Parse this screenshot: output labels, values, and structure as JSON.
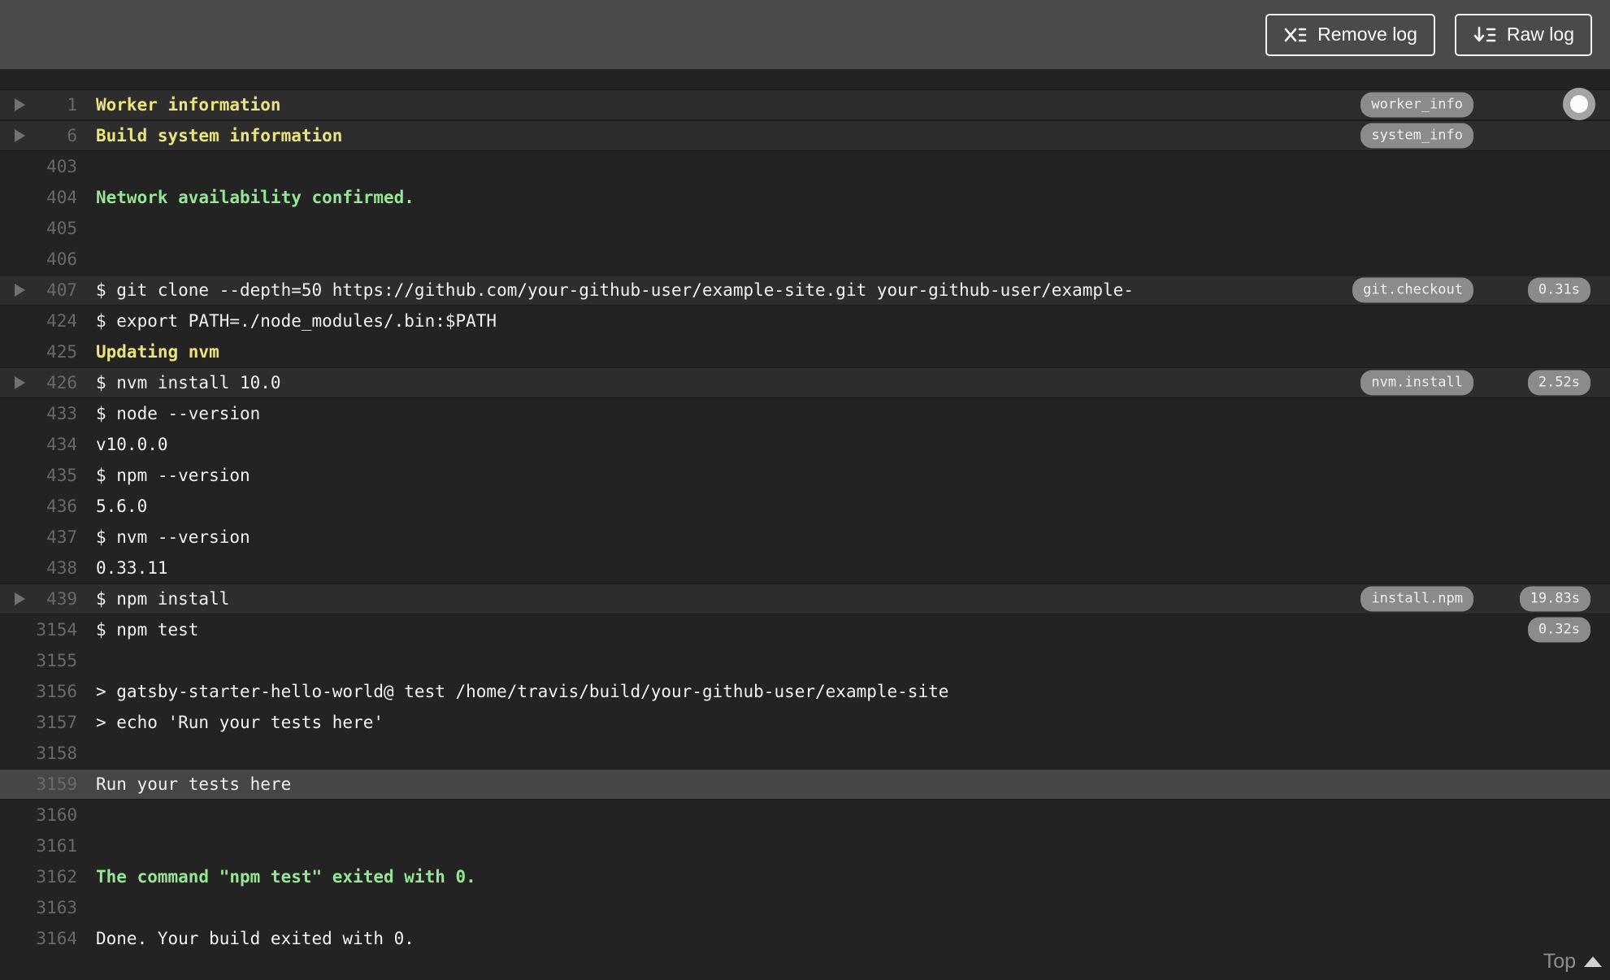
{
  "toolbar": {
    "remove_log_label": "Remove log",
    "raw_log_label": "Raw log"
  },
  "footer": {
    "top_label": "Top"
  },
  "colors": {
    "toolbar_bg": "#4a4a4a",
    "log_bg": "#232323",
    "highlight_row_bg": "#2d2d2d",
    "selected_row_bg": "#464646",
    "fold_title_yellow": "#e9e47c",
    "success_green": "#95e595",
    "log_text": "#f2f2f2",
    "badge_bg": "#8b8b8b"
  },
  "icons": [
    "remove-log-icon",
    "raw-log-icon",
    "fold-toggle-icon",
    "scroll-thumb",
    "top-arrow-icon"
  ],
  "log": {
    "lines": [
      {
        "number": "1",
        "text": "Worker information",
        "style": "fold-title",
        "fold": true,
        "highlight": true,
        "tag": "worker_info"
      },
      {
        "number": "6",
        "text": "Build system information",
        "style": "fold-title",
        "fold": true,
        "highlight": true,
        "tag": "system_info"
      },
      {
        "number": "403",
        "text": ""
      },
      {
        "number": "404",
        "text": "Network availability confirmed.",
        "style": "success"
      },
      {
        "number": "405",
        "text": ""
      },
      {
        "number": "406",
        "text": ""
      },
      {
        "number": "407",
        "text": "$ git clone --depth=50 https://github.com/your-github-user/example-site.git your-github-user/example-",
        "fold": true,
        "highlight": true,
        "tag": "git.checkout",
        "duration": "0.31s"
      },
      {
        "number": "424",
        "text": "$ export PATH=./node_modules/.bin:$PATH"
      },
      {
        "number": "425",
        "text": "Updating nvm",
        "style": "fold-title"
      },
      {
        "number": "426",
        "text": "$ nvm install 10.0",
        "fold": true,
        "highlight": true,
        "tag": "nvm.install",
        "duration": "2.52s"
      },
      {
        "number": "433",
        "text": "$ node --version"
      },
      {
        "number": "434",
        "text": "v10.0.0"
      },
      {
        "number": "435",
        "text": "$ npm --version"
      },
      {
        "number": "436",
        "text": "5.6.0"
      },
      {
        "number": "437",
        "text": "$ nvm --version"
      },
      {
        "number": "438",
        "text": "0.33.11"
      },
      {
        "number": "439",
        "text": "$ npm install",
        "fold": true,
        "highlight": true,
        "tag": "install.npm",
        "duration": "19.83s"
      },
      {
        "number": "3154",
        "text": "$ npm test",
        "duration": "0.32s"
      },
      {
        "number": "3155",
        "text": ""
      },
      {
        "number": "3156",
        "text": "> gatsby-starter-hello-world@ test /home/travis/build/your-github-user/example-site"
      },
      {
        "number": "3157",
        "text": "> echo 'Run your tests here'"
      },
      {
        "number": "3158",
        "text": ""
      },
      {
        "number": "3159",
        "text": "Run your tests here",
        "selected": true
      },
      {
        "number": "3160",
        "text": ""
      },
      {
        "number": "3161",
        "text": ""
      },
      {
        "number": "3162",
        "text": "The command \"npm test\" exited with 0.",
        "style": "success"
      },
      {
        "number": "3163",
        "text": ""
      },
      {
        "number": "3164",
        "text": "Done. Your build exited with 0."
      }
    ]
  }
}
